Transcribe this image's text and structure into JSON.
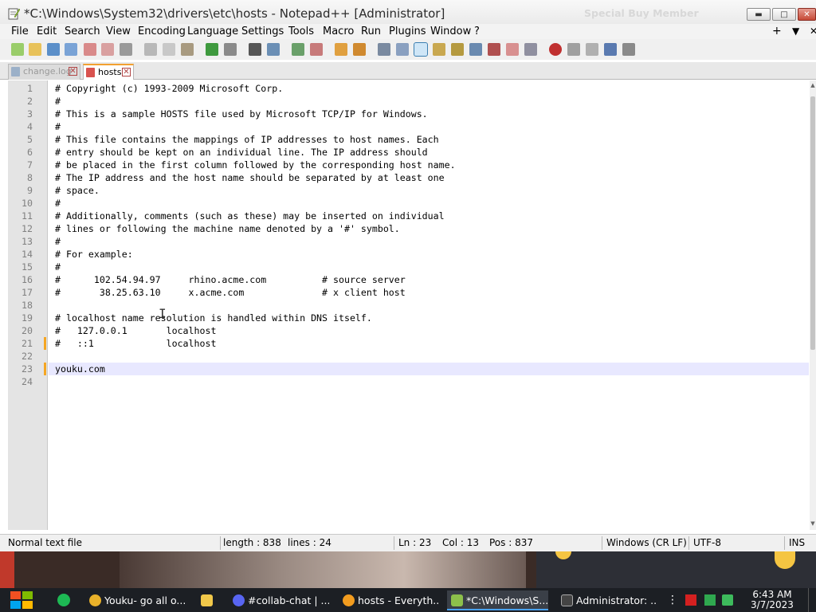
{
  "window": {
    "title": "*C:\\Windows\\System32\\drivers\\etc\\hosts - Notepad++ [Administrator]",
    "minimize_glyph": "▬",
    "maximize_glyph": "□",
    "close_glyph": "✕"
  },
  "menu": {
    "items": [
      "File",
      "Edit",
      "Search",
      "View",
      "Encoding",
      "Language",
      "Settings",
      "Tools",
      "Macro",
      "Run",
      "Plugins",
      "Window",
      "?"
    ],
    "right_plus": "+",
    "right_down": "▼",
    "right_close": "✕"
  },
  "tabs": [
    {
      "label": "change.log",
      "active": false,
      "close": "✕"
    },
    {
      "label": "hosts",
      "active": true,
      "close": "✕"
    }
  ],
  "editor": {
    "lines": [
      "# Copyright (c) 1993-2009 Microsoft Corp.",
      "#",
      "# This is a sample HOSTS file used by Microsoft TCP/IP for Windows.",
      "#",
      "# This file contains the mappings of IP addresses to host names. Each",
      "# entry should be kept on an individual line. The IP address should",
      "# be placed in the first column followed by the corresponding host name.",
      "# The IP address and the host name should be separated by at least one",
      "# space.",
      "#",
      "# Additionally, comments (such as these) may be inserted on individual",
      "# lines or following the machine name denoted by a '#' symbol.",
      "#",
      "# For example:",
      "#",
      "#      102.54.94.97     rhino.acme.com          # source server",
      "#       38.25.63.10     x.acme.com              # x client host",
      "",
      "# localhost name resolution is handled within DNS itself.",
      "#   127.0.0.1       localhost",
      "#   ::1             localhost",
      "",
      "youku.com",
      ""
    ],
    "line_numbers": [
      "1",
      "2",
      "3",
      "4",
      "5",
      "6",
      "7",
      "8",
      "9",
      "10",
      "11",
      "12",
      "13",
      "14",
      "15",
      "16",
      "17",
      "18",
      "19",
      "20",
      "21",
      "22",
      "23",
      "24"
    ],
    "current_line": 23,
    "changed_lines": [
      21,
      23
    ],
    "cursor_glyph": "I"
  },
  "statusbar": {
    "file_type": "Normal text file",
    "length": "length : 838",
    "lines": "lines : 24",
    "ln": "Ln : 23",
    "col": "Col : 13",
    "pos": "Pos : 837",
    "eol": "Windows (CR LF)",
    "encoding": "UTF-8",
    "mode": "INS"
  },
  "background": {
    "promo_text": "Special Buy Member"
  },
  "taskbar": {
    "tasks": [
      {
        "label": "Youku- go all o...",
        "icon": "chrome-icon",
        "color": "#e8b12a",
        "active": false
      },
      {
        "label": "",
        "icon": "folder-icon",
        "color": "#f1c84a",
        "active": false
      },
      {
        "label": "#collab-chat | ...",
        "icon": "discord-icon",
        "color": "#5865f2",
        "active": false
      },
      {
        "label": "hosts - Everyth...",
        "icon": "search-icon",
        "color": "#f29c1f",
        "active": false
      },
      {
        "label": "*C:\\Windows\\S...",
        "icon": "notepadpp-icon",
        "color": "#8dc04b",
        "active": true
      },
      {
        "label": "Administrator: ...",
        "icon": "cmd-icon",
        "color": "#444444",
        "active": false
      }
    ],
    "time": "6:43 AM",
    "date": "3/7/2023"
  },
  "colors": {
    "current_line_bg": "#e8e8ff",
    "change_marker": "#f5a623",
    "tab_active_accent": "#f2a030",
    "taskbar_bg": "#1c1f24"
  }
}
